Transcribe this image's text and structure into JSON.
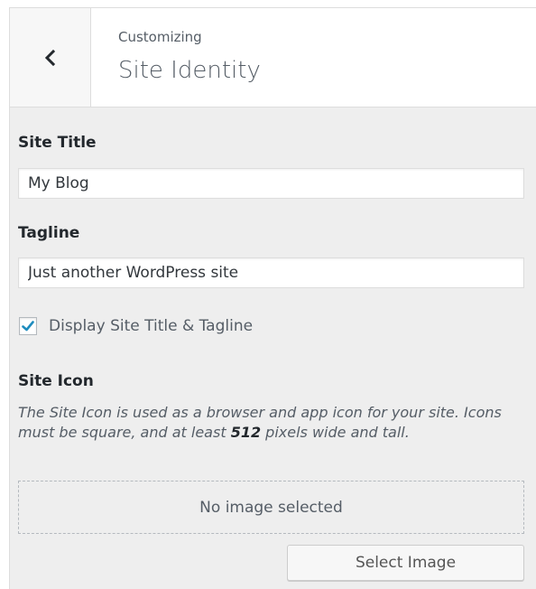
{
  "header": {
    "context": "Customizing",
    "title": "Site Identity"
  },
  "site_title": {
    "label": "Site Title",
    "value": "My Blog"
  },
  "tagline": {
    "label": "Tagline",
    "value": "Just another WordPress site"
  },
  "display_checkbox": {
    "label": "Display Site Title & Tagline",
    "checked": true
  },
  "site_icon": {
    "label": "Site Icon",
    "description_before": "The Site Icon is used as a browser and app icon for your site. Icons must be square, and at least ",
    "description_bold": "512",
    "description_after": " pixels wide and tall.",
    "placeholder": "No image selected",
    "button_label": "Select Image"
  },
  "icons": {
    "back": "chevron-left-icon",
    "check": "checkmark-icon"
  },
  "colors": {
    "check": "#1e8cbe",
    "panel_bg": "#eeeeee"
  }
}
